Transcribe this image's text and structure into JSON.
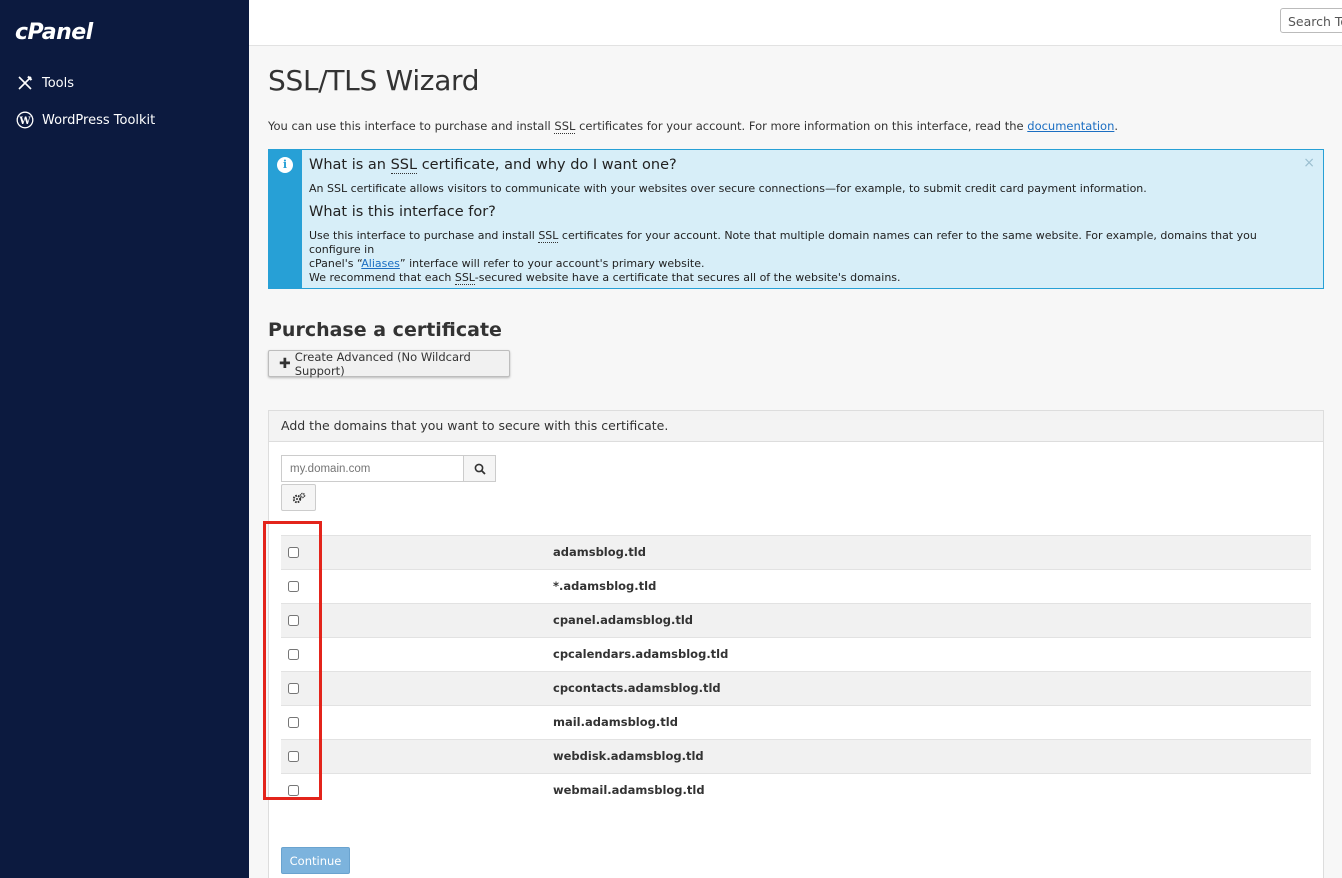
{
  "sidebar": {
    "logo": "cPanel",
    "items": [
      {
        "label": "Tools",
        "icon": "tools-icon"
      },
      {
        "label": "WordPress Toolkit",
        "icon": "wordpress-icon"
      }
    ]
  },
  "topbar": {
    "search_text": "Search Tools"
  },
  "page": {
    "title": "SSL/TLS Wizard",
    "intro_before_ssl": "You can use this interface to purchase and install ",
    "ssl": "SSL",
    "intro_after_ssl": " certificates for your account. For more information on this interface, read the ",
    "doc_link": "documentation",
    "intro_end": "."
  },
  "info": {
    "close": "×",
    "icon_letter": "i",
    "h1_before": "What is an ",
    "h1_ssl": "SSL",
    "h1_after": " certificate, and why do I want one?",
    "p1": "An SSL certificate allows visitors to communicate with your websites over secure connections—for example, to submit credit card payment information.",
    "h2": "What is this interface for?",
    "p2_a": "Use this interface to purchase and install ",
    "p2_ssl": "SSL",
    "p2_b": " certificates for your account. Note that multiple domain names can refer to the same website. For example, domains that you configure in",
    "p2_c": "cPanel's “",
    "p2_link": "Aliases",
    "p2_d": "” interface will refer to your account's primary website.",
    "p3_a": "We recommend that each ",
    "p3_ssl": "SSL",
    "p3_b": "-secured website have a certificate that secures all of the website's domains."
  },
  "purchase": {
    "title": "Purchase a certificate",
    "advanced_plus": "✚",
    "advanced_label": "Create Advanced (No Wildcard Support)"
  },
  "domains_panel": {
    "header": "Add the domains that you want to secure with this certificate.",
    "input_placeholder": "my.domain.com",
    "rows": [
      {
        "name": "adamsblog.tld",
        "checked": false
      },
      {
        "name": "*.adamsblog.tld",
        "checked": false
      },
      {
        "name": "cpanel.adamsblog.tld",
        "checked": false
      },
      {
        "name": "cpcalendars.adamsblog.tld",
        "checked": false
      },
      {
        "name": "cpcontacts.adamsblog.tld",
        "checked": false
      },
      {
        "name": "mail.adamsblog.tld",
        "checked": false
      },
      {
        "name": "webdisk.adamsblog.tld",
        "checked": false
      },
      {
        "name": "webmail.adamsblog.tld",
        "checked": false
      }
    ],
    "continue_label": "Continue"
  },
  "colors": {
    "sidebar_bg": "#0c1a3f",
    "info_accent": "#27a0d6",
    "highlight": "#e3241b",
    "continue_bg": "#7cb3dd"
  }
}
